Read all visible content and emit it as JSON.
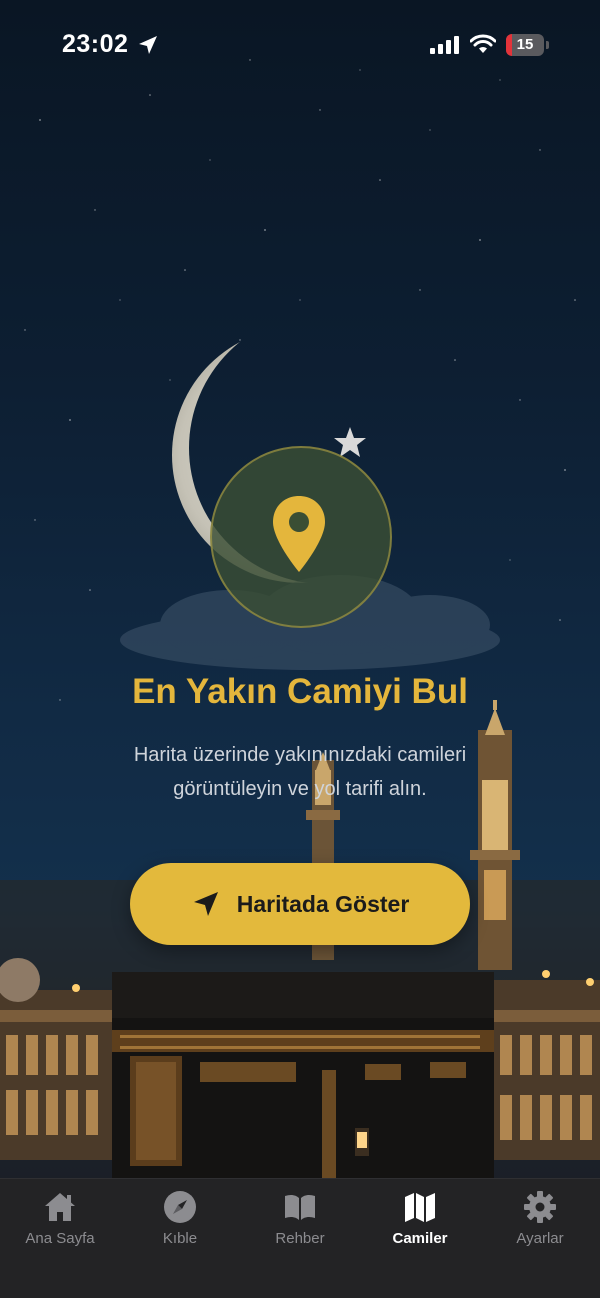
{
  "status_bar": {
    "time": "23:02",
    "battery_level": 15,
    "battery_label": "15",
    "icons": [
      "location-arrow-icon",
      "signal-icon",
      "wifi-icon",
      "battery-icon"
    ]
  },
  "hero": {
    "title": "En Yakın Camiyi Bul",
    "subtitle_line1": "Harita üzerinde yakınınızdaki camileri",
    "subtitle_line2": "görüntüleyin ve yol tarifi alın.",
    "icon": "location-pin-icon"
  },
  "cta": {
    "label": "Haritada Göster",
    "icon": "navigation-arrow-icon"
  },
  "tab_bar": {
    "items": [
      {
        "label": "Ana Sayfa",
        "icon": "home-icon",
        "active": false
      },
      {
        "label": "Kıble",
        "icon": "compass-icon",
        "active": false
      },
      {
        "label": "Rehber",
        "icon": "book-icon",
        "active": false
      },
      {
        "label": "Camiler",
        "icon": "map-icon",
        "active": true
      },
      {
        "label": "Ayarlar",
        "icon": "gear-icon",
        "active": false
      }
    ]
  },
  "colors": {
    "accent": "#e3b93c",
    "title": "#e4b63c",
    "background": "#0d1f33",
    "tab_bar": "#232325"
  }
}
